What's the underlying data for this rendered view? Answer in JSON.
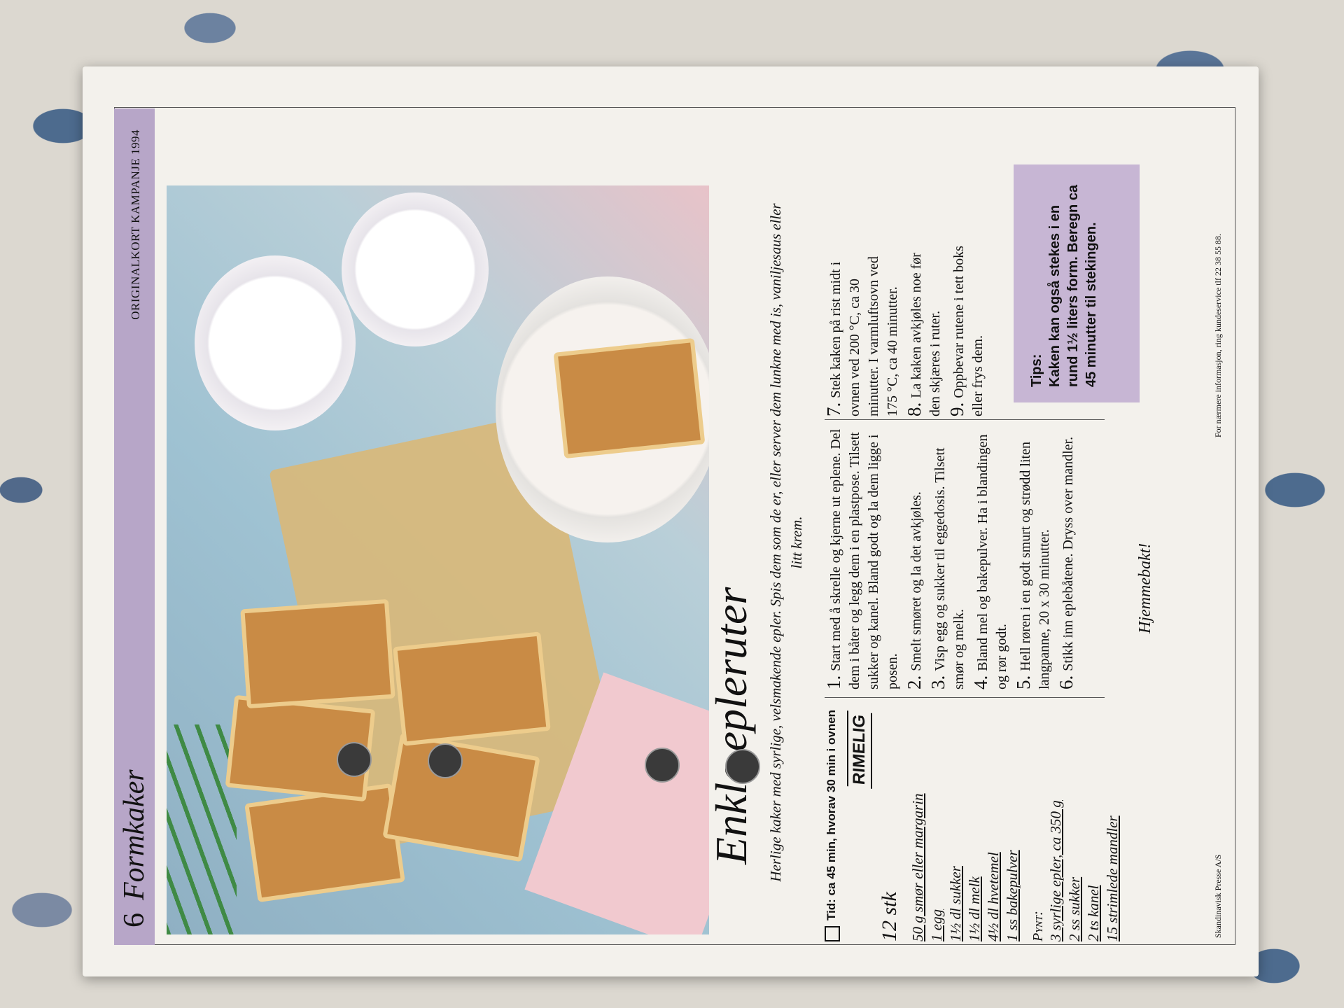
{
  "header": {
    "chapter_number": "6",
    "chapter_title": "Formkaker",
    "campaign": "ORIGINALKORT KAMPANJE 1994"
  },
  "recipe": {
    "title": "Enkle epleruter",
    "subtitle": "Herlige kaker med syrlige, velsmakende epler. Spis dem som de er, eller server dem lunkne med is, vaniljesaus eller litt krem.",
    "time": "Tid: ca 45 min, hvorav 30 min i ovnen",
    "badge": "RIMELIG",
    "servings": "12 stk",
    "ingredients": [
      "50 g smør eller margarin",
      "1 egg",
      "1½ dl sukker",
      "1½ dl melk",
      "4½ dl hvetemel",
      "1 ss bakepulver"
    ],
    "garnish_label": "Pynt:",
    "garnish": [
      "3 syrlige epler, ca 350 g",
      "2 ss sukker",
      "2 ts kanel",
      "15 strimlede mandler"
    ],
    "steps_col1": [
      {
        "n": "1.",
        "text": "Start med å skrelle og kjerne ut eplene. Del dem i båter og legg dem i en plastpose. Tilsett sukker og kanel. Bland godt og la dem ligge i posen."
      },
      {
        "n": "2.",
        "text": "Smelt smøret og la det avkjøles."
      },
      {
        "n": "3.",
        "text": "Visp egg og sukker til eggedosis. Tilsett smør og melk."
      },
      {
        "n": "4.",
        "text": "Bland mel og bakepulver. Ha i blandingen og rør godt."
      },
      {
        "n": "5.",
        "text": "Hell røren i en godt smurt og strødd liten langpanne, 20 x 30 minutter."
      },
      {
        "n": "6.",
        "text": "Stikk inn eplebåtene. Dryss over mandler."
      }
    ],
    "steps_col2": [
      {
        "n": "7.",
        "text": "Stek kaken på rist midt i ovnen ved 200 °C, ca 30 minutter. I varmluftsovn ved 175 °C, ca 40 minutter."
      },
      {
        "n": "8.",
        "text": "La kaken avkjøles noe før den skjæres i ruter."
      },
      {
        "n": "9.",
        "text": "Oppbevar rutene i tett boks eller frys dem."
      }
    ],
    "tips_label": "Tips:",
    "tips_text": "Kaken kan også stekes i en rund 1½ liters form. Beregn ca 45 minutter til stekingen.",
    "signoff": "Hjemmebakt!"
  },
  "footer": {
    "publisher": "Skandinavisk Presse A/S",
    "info": "For nærmere informasjon, ring kundeservice tlf 22 38 55 88."
  }
}
